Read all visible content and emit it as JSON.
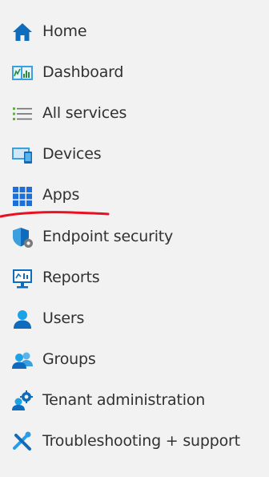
{
  "sidebar": {
    "items": [
      {
        "label": "Home",
        "icon": "home-icon"
      },
      {
        "label": "Dashboard",
        "icon": "dashboard-icon"
      },
      {
        "label": "All services",
        "icon": "all-services-icon"
      },
      {
        "label": "Devices",
        "icon": "devices-icon"
      },
      {
        "label": "Apps",
        "icon": "apps-icon"
      },
      {
        "label": "Endpoint security",
        "icon": "endpoint-security-icon"
      },
      {
        "label": "Reports",
        "icon": "reports-icon"
      },
      {
        "label": "Users",
        "icon": "users-icon"
      },
      {
        "label": "Groups",
        "icon": "groups-icon"
      },
      {
        "label": "Tenant administration",
        "icon": "tenant-administration-icon"
      },
      {
        "label": "Troubleshooting + support",
        "icon": "troubleshooting-icon"
      }
    ]
  },
  "colors": {
    "background": "#f2f2f2",
    "text": "#323130",
    "accent": "#0078d4",
    "annotation": "#e81123"
  }
}
